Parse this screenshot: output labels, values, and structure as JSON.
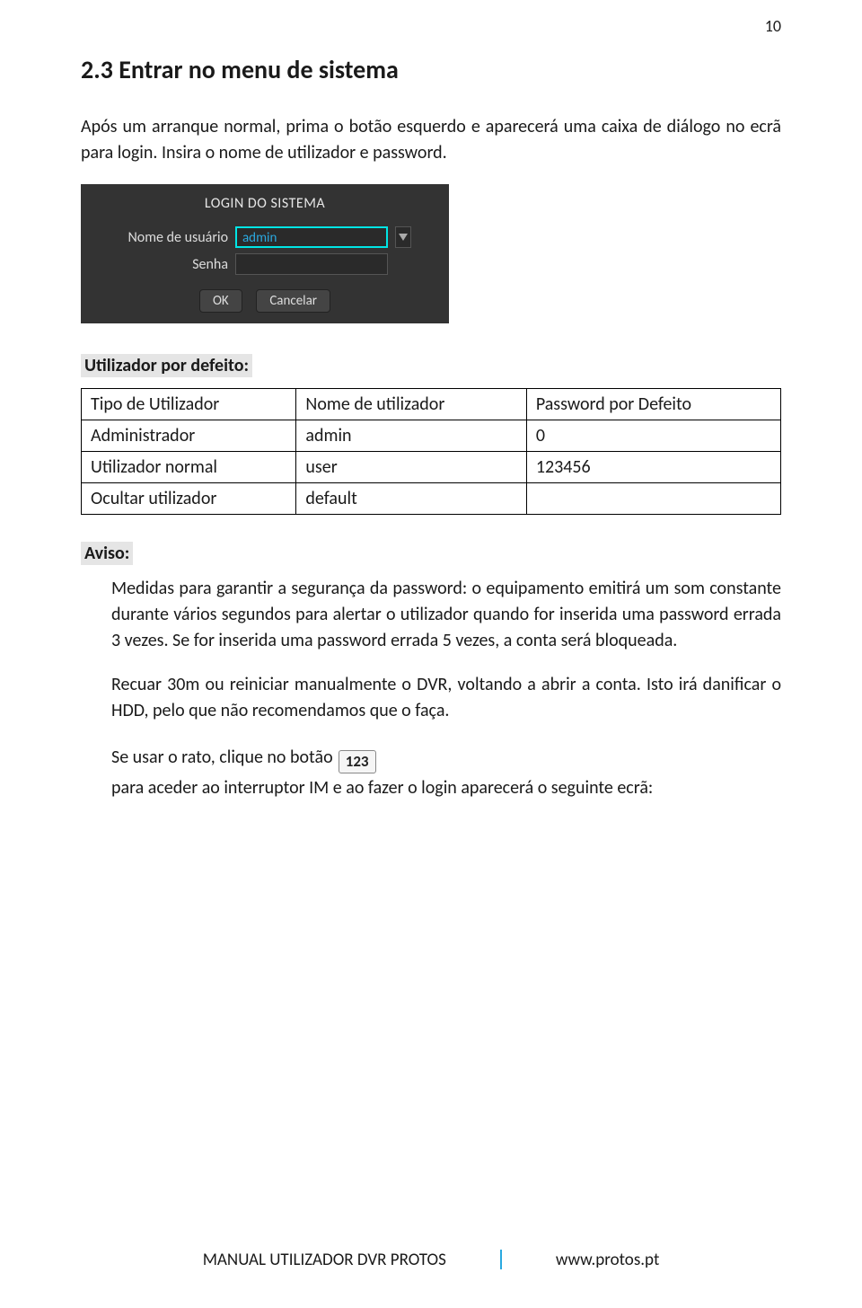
{
  "page_number": "10",
  "heading": "2.3 Entrar no menu de sistema",
  "intro": "Após um arranque normal, prima o botão esquerdo e aparecerá uma caixa de diálogo no ecrã para login. Insira o nome de utilizador e password.",
  "login": {
    "title": "LOGIN DO SISTEMA",
    "user_label": "Nome de usuário",
    "user_value": "admin",
    "pass_label": "Senha",
    "pass_value": "",
    "ok": "OK",
    "cancel": "Cancelar"
  },
  "defaults_label": "Utilizador por defeito:",
  "defaults_table": {
    "headers": [
      "Tipo de Utilizador",
      "Nome de utilizador",
      "Password por Defeito"
    ],
    "rows": [
      [
        "Administrador",
        "admin",
        "0"
      ],
      [
        "Utilizador normal",
        "user",
        "123456"
      ],
      [
        "Ocultar utilizador",
        "default",
        ""
      ]
    ]
  },
  "aviso_label": "Aviso:",
  "aviso_p1": "Medidas para garantir a segurança da password: o equipamento emitirá um som constante durante vários segundos para alertar o utilizador quando for inserida uma password errada 3 vezes. Se for inserida uma password errada 5 vezes, a conta será bloqueada.",
  "aviso_p2": "Recuar 30m ou reiniciar manualmente o DVR, voltando a abrir a conta. Isto irá danificar o HDD, pelo que não recomendamos que o faça.",
  "aviso_p3a": "Se usar o rato, clique no botão",
  "aviso_icon": "123",
  "aviso_p3b": "para aceder ao interruptor IM e ao fazer o login aparecerá o seguinte ecrã:",
  "footer": {
    "left": "MANUAL UTILIZADOR DVR PROTOS",
    "right": "www.protos.pt"
  }
}
